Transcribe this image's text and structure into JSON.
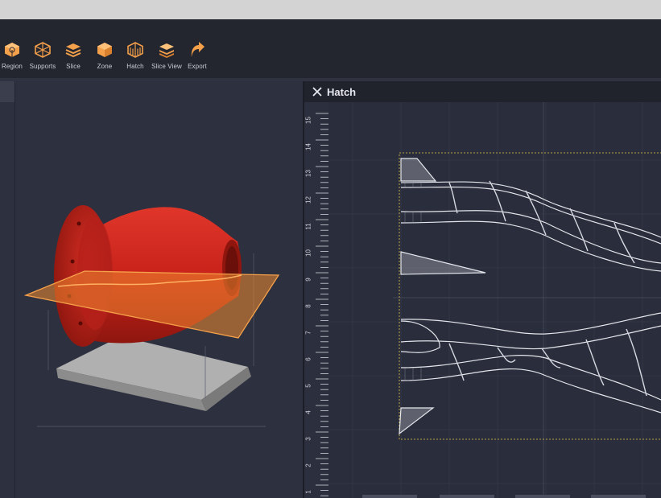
{
  "toolbar": {
    "tools": [
      {
        "label": "Region",
        "icon": "region-icon"
      },
      {
        "label": "Supports",
        "icon": "supports-icon"
      },
      {
        "label": "Slice",
        "icon": "slice-icon"
      },
      {
        "label": "Zone",
        "icon": "zone-icon"
      },
      {
        "label": "Hatch",
        "icon": "hatch-icon"
      },
      {
        "label": "Slice View",
        "icon": "slice-view-icon"
      },
      {
        "label": "Export",
        "icon": "export-icon"
      }
    ],
    "accent_color": "#f5a04a"
  },
  "hatch_panel": {
    "title": "Hatch",
    "close_icon": "close-icon",
    "ruler_ticks": [
      "15",
      "14",
      "13",
      "12",
      "11",
      "10",
      "9",
      "8",
      "7",
      "6",
      "5",
      "4",
      "3",
      "2",
      "1"
    ]
  },
  "viewport": {
    "model_color": "#c8231a",
    "plane_color": "#f08a30",
    "platform_color": "#a8a8a8"
  }
}
